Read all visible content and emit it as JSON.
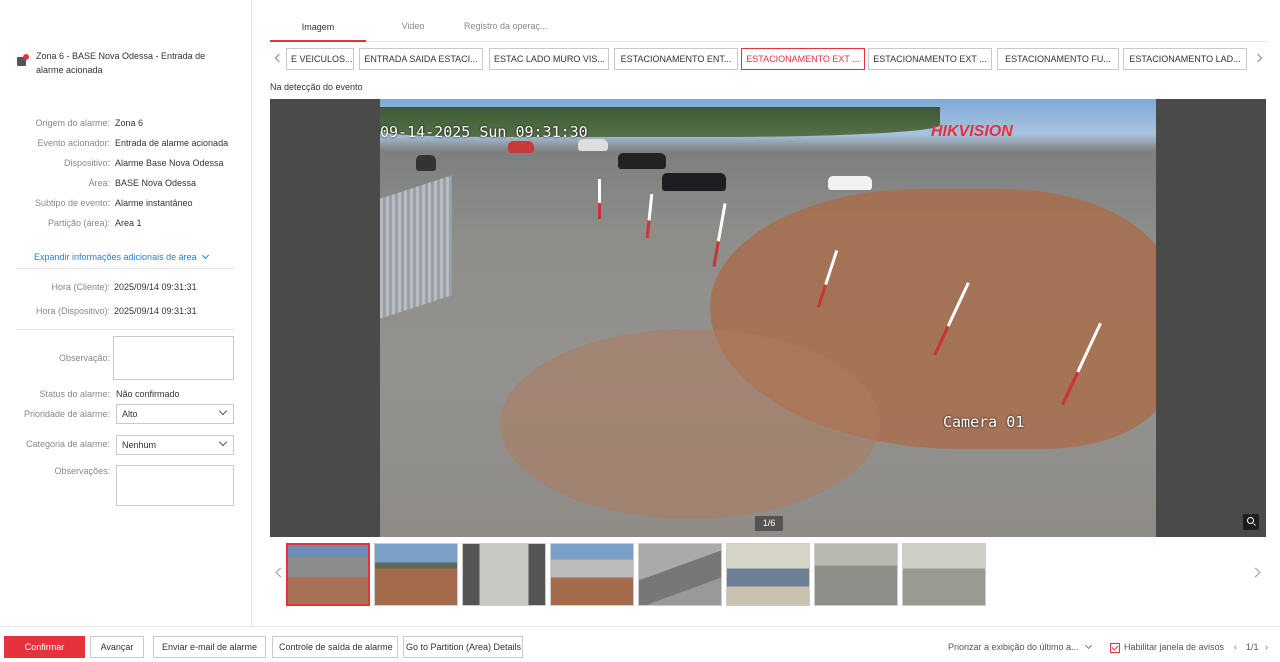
{
  "alarm": {
    "title": "Zona 6 - BASE Nova Odessa - Entrada de alarme acionada"
  },
  "details": [
    {
      "key": "Origem do alarme:",
      "value": "Zona 6"
    },
    {
      "key": "Evento acionador:",
      "value": "Entrada de alarme acionada"
    },
    {
      "key": "Dispositivo:",
      "value": "Alarme Base Nova Odessa"
    },
    {
      "key": "Área:",
      "value": "BASE Nova Odessa"
    },
    {
      "key": "Subtipo de evento:",
      "value": "Alarme instantâneo"
    },
    {
      "key": "Partição (área):",
      "value": "Area 1"
    }
  ],
  "expand_label": "Expandir informações adicionais de área",
  "times": [
    {
      "key": "Hora (Cliente):",
      "value": "2025/09/14 09:31:31"
    },
    {
      "key": "Hora (Dispositivo):",
      "value": "2025/09/14 09:31:31"
    }
  ],
  "form": {
    "observacao_label": "Observação:",
    "status_label": "Status do alarme:",
    "status_value": "Não confirmado",
    "priority_label": "Prioridade de alarme:",
    "priority_value": "Alto",
    "category_label": "Categoria de alarme:",
    "category_value": "Nenhum",
    "observacoes_label": "Observações:"
  },
  "tabs": [
    "Imagem",
    "Video",
    "Registro da operaç..."
  ],
  "cameras": [
    "E VEICULOS...",
    "ENTRADA SAIDA ESTACI...",
    "ESTAC LADO MURO VIS...",
    "ESTACIONAMENTO ENT...",
    "ESTACIONAMENTO EXT ...",
    "ESTACIONAMENTO EXT ...",
    "ESTACIONAMENTO FU...",
    "ESTACIONAMENTO LAD..."
  ],
  "detection_label": "Na detecção do evento",
  "viewer": {
    "osd_date": "09-14-2025 Sun 09:31:30",
    "osd_brand": "HIKVISION",
    "osd_camera": "Camera 01",
    "counter": "1/6"
  },
  "footer": {
    "confirm": "Confirmar",
    "advance": "Avançar",
    "email": "Enviar e-mail de alarme",
    "exit_control": "Controle de saída de alarme",
    "partition": "Go to Partition (Area) Details",
    "priority_display": "Priorizar a exibição do último a...",
    "enable_popup": "Habilitar janela de avisos",
    "page": "1/1"
  },
  "colors": {
    "accent": "#e5323c",
    "link": "#2b7fd3"
  }
}
